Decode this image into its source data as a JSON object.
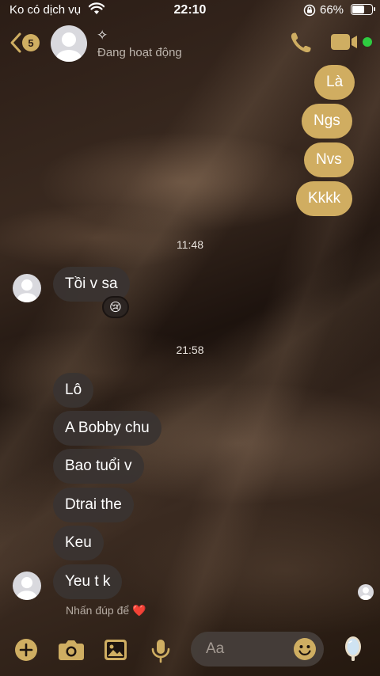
{
  "status": {
    "carrier": "Ko có dịch vụ",
    "time": "22:10",
    "battery": "66%",
    "battery_level": 0.66
  },
  "header": {
    "back_badge": "5",
    "sparkle": "✧",
    "active_status": "Đang hoạt động"
  },
  "messages": {
    "sent": [
      "Là",
      "Ngs",
      "Nvs",
      "Kkkk"
    ],
    "time1": "11:48",
    "first_received": "Tồi v sa",
    "reaction": "😢",
    "time2": "21:58",
    "received": [
      "Lô",
      "A Bobby chu",
      "Bao tuổi v",
      "Dtrai the",
      "Keu",
      "Yeu t k"
    ]
  },
  "hint": "Nhấn đúp để ❤️",
  "composer": {
    "placeholder": "Aa"
  },
  "colors": {
    "accent": "#d0ad61",
    "online": "#2ecc40",
    "received_bubble": "#3a3432"
  },
  "icons": [
    "wifi-icon",
    "lock-rotation-icon",
    "battery-icon",
    "chevron-left-icon",
    "avatar-icon",
    "phone-icon",
    "video-camera-icon",
    "plus-icon",
    "camera-icon",
    "image-icon",
    "microphone-icon",
    "smiley-icon",
    "mirror-icon"
  ]
}
